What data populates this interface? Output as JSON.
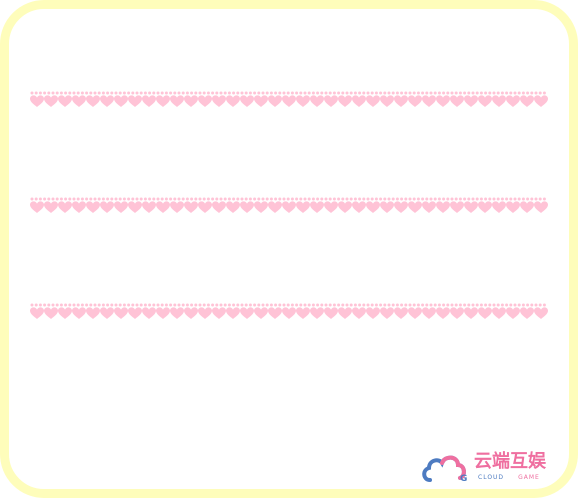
{
  "colors": {
    "frame": "#fefdbb",
    "background": "#ffffff",
    "heart": "#ffc3d6",
    "dot": "#ffc3d6",
    "logo_pink": "#ef6fa0",
    "logo_blue": "#4d7bc1"
  },
  "dividers": [
    {
      "icon": "heart-border-icon"
    },
    {
      "icon": "heart-border-icon"
    },
    {
      "icon": "heart-border-icon"
    }
  ],
  "watermark": {
    "icon": "cloud-logo-icon",
    "letter": "G",
    "name_cn": "云端互娱",
    "name_en_1": "CLOUD",
    "name_en_2": "GAME"
  }
}
